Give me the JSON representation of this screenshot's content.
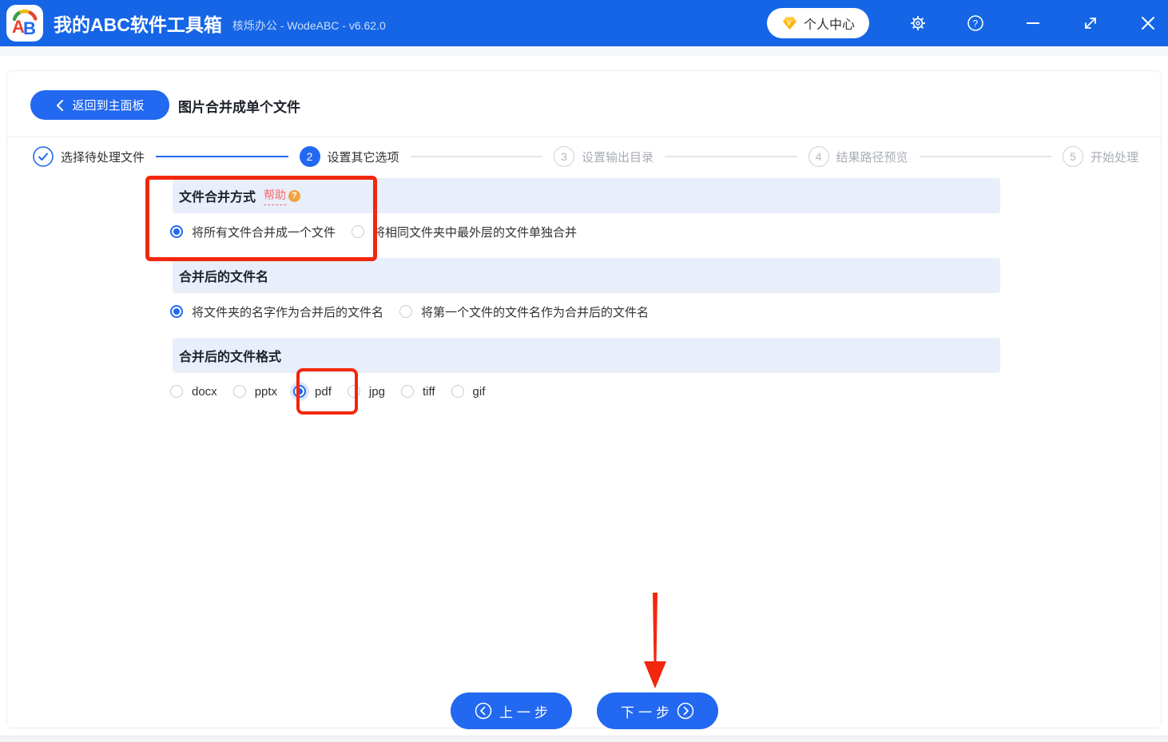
{
  "colors": {
    "titlebar_blue": "#1565e6",
    "accent_blue": "#2268f0",
    "section_band_blue": "#e8eefa",
    "annotation_red": "#f1270e",
    "help_link_red": "#f56c6c",
    "help_badge_orange": "#f0a33f",
    "vip_diamond_yellow": "#ffb300"
  },
  "titlebar": {
    "logo_text": "AB",
    "app_title": "我的ABC软件工具箱",
    "app_subtitle": "核烁办公 - WodeABC - v6.62.0",
    "user_center_label": "个人中心",
    "icons": [
      "vip-diamond-icon",
      "settings-gear-icon",
      "help-circle-icon",
      "minimize-icon",
      "resize-icon",
      "close-icon"
    ]
  },
  "header": {
    "back_label": "返回到主面板",
    "page_title": "图片合并成单个文件"
  },
  "steps": [
    {
      "number": "1",
      "label": "选择待处理文件",
      "state": "done"
    },
    {
      "number": "2",
      "label": "设置其它选项",
      "state": "active"
    },
    {
      "number": "3",
      "label": "设置输出目录",
      "state": "pending"
    },
    {
      "number": "4",
      "label": "结果路径预览",
      "state": "pending"
    },
    {
      "number": "5",
      "label": "开始处理",
      "state": "pending"
    }
  ],
  "sections": [
    {
      "title": "文件合并方式",
      "help_label": "帮助",
      "help_badge": "?",
      "options": [
        {
          "label": "将所有文件合并成一个文件",
          "selected": true
        },
        {
          "label": "将相同文件夹中最外层的文件单独合并",
          "selected": false
        }
      ]
    },
    {
      "title": "合并后的文件名",
      "options": [
        {
          "label": "将文件夹的名字作为合并后的文件名",
          "selected": true
        },
        {
          "label": "将第一个文件的文件名作为合并后的文件名",
          "selected": false
        }
      ]
    },
    {
      "title": "合并后的文件格式",
      "options": [
        {
          "label": "docx",
          "selected": false
        },
        {
          "label": "pptx",
          "selected": false
        },
        {
          "label": "pdf",
          "selected": true
        },
        {
          "label": "jpg",
          "selected": false
        },
        {
          "label": "tiff",
          "selected": false
        },
        {
          "label": "gif",
          "selected": false
        }
      ]
    }
  ],
  "footer": {
    "prev_label": "上一步",
    "next_label": "下一步"
  },
  "annotations": {
    "box1_target": "文件合并方式区域",
    "box2_target": "pdf 选项",
    "arrow_target": "下一步按钮"
  }
}
